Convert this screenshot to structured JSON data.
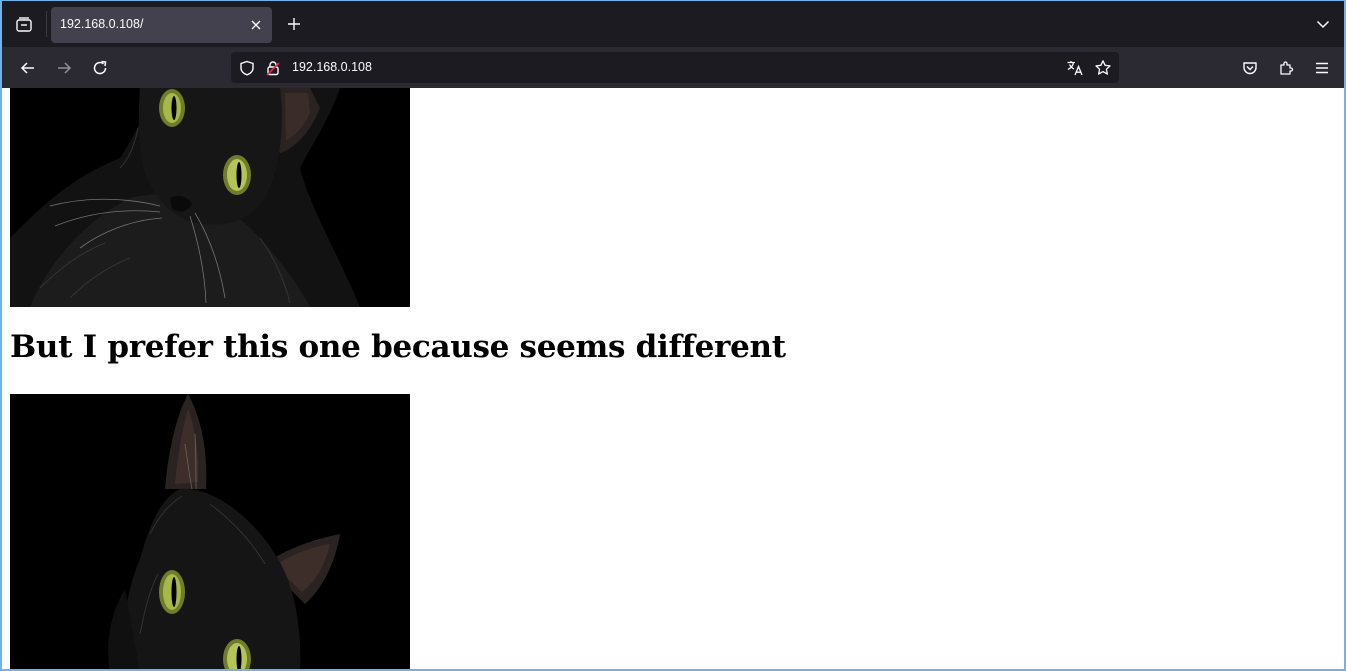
{
  "browser": {
    "tab": {
      "title": "192.168.0.108/"
    },
    "url": "192.168.0.108",
    "icons": {
      "overview": "tab-overview-icon",
      "close": "close-icon",
      "new_tab": "plus-icon",
      "tab_list": "chevron-down-icon",
      "back": "arrow-left-icon",
      "forward": "arrow-right-icon",
      "reload": "reload-icon",
      "shield": "shield-icon",
      "lock": "insecure-lock-icon",
      "translate": "translate-icon",
      "bookmark": "star-icon",
      "pocket": "pocket-icon",
      "extensions": "puzzle-icon",
      "menu": "hamburger-icon"
    }
  },
  "page": {
    "images": [
      {
        "description": "black-cat-photo"
      },
      {
        "description": "black-cat-photo"
      }
    ],
    "heading": "But I prefer this one because seems different"
  },
  "colors": {
    "tab_strip": "#1c1b22",
    "nav_bar": "#2b2a33",
    "active_tab": "#42414d",
    "window_border": "#6fb3e8"
  }
}
